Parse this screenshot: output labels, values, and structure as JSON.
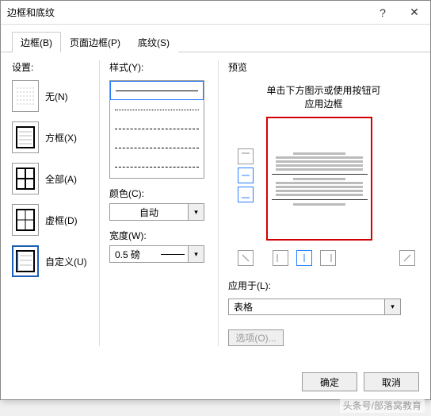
{
  "title": "边框和底纹",
  "tabs": {
    "border": "边框(B)",
    "page_border": "页面边框(P)",
    "shading": "底纹(S)"
  },
  "settings": {
    "label": "设置:",
    "none": "无(N)",
    "box": "方框(X)",
    "all": "全部(A)",
    "grid": "虚框(D)",
    "custom": "自定义(U)"
  },
  "style": {
    "label": "样式(Y):"
  },
  "color": {
    "label": "颜色(C):",
    "value": "自动"
  },
  "width": {
    "label": "宽度(W):",
    "value": "0.5 磅"
  },
  "preview": {
    "label": "预览",
    "hint1": "单击下方图示或使用按钮可",
    "hint2": "应用边框"
  },
  "apply": {
    "label": "应用于(L):",
    "value": "表格"
  },
  "options": "选项(O)...",
  "ok": "确定",
  "cancel": "取消",
  "watermark": "头条号/部落窝教育"
}
